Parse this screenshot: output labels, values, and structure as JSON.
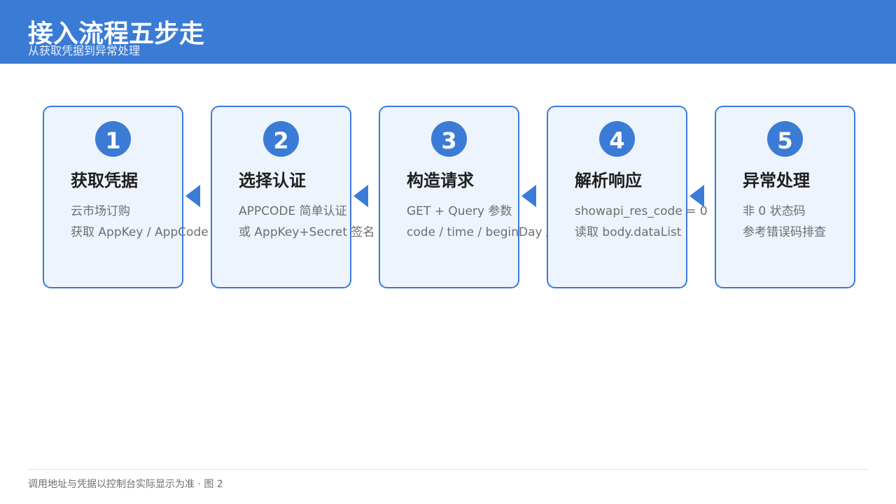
{
  "header": {
    "title": "接入流程五步走",
    "subtitle": "从获取凭据到异常处理"
  },
  "steps": [
    {
      "number": "1",
      "title": "获取凭据",
      "lines": [
        "云市场订购",
        "获取 AppKey / AppCode"
      ]
    },
    {
      "number": "2",
      "title": "选择认证",
      "lines": [
        "APPCODE 简单认证",
        "或 AppKey+Secret 签名"
      ]
    },
    {
      "number": "3",
      "title": "构造请求",
      "lines": [
        "GET + Query 参数",
        "code / time / beginDay /"
      ]
    },
    {
      "number": "4",
      "title": "解析响应",
      "lines": [
        "showapi_res_code = 0",
        "读取 body.dataList"
      ]
    },
    {
      "number": "5",
      "title": "异常处理",
      "lines": [
        "非 0 状态码",
        "参考错误码排查"
      ]
    }
  ],
  "footer": {
    "note": "调用地址与凭据以控制台实际显示为准 · 图 2"
  },
  "colors": {
    "accent": "#3a7bd5",
    "card_background": "#eef4fd",
    "title_text": "#1e1e1e",
    "body_text": "#6e6e6e"
  }
}
